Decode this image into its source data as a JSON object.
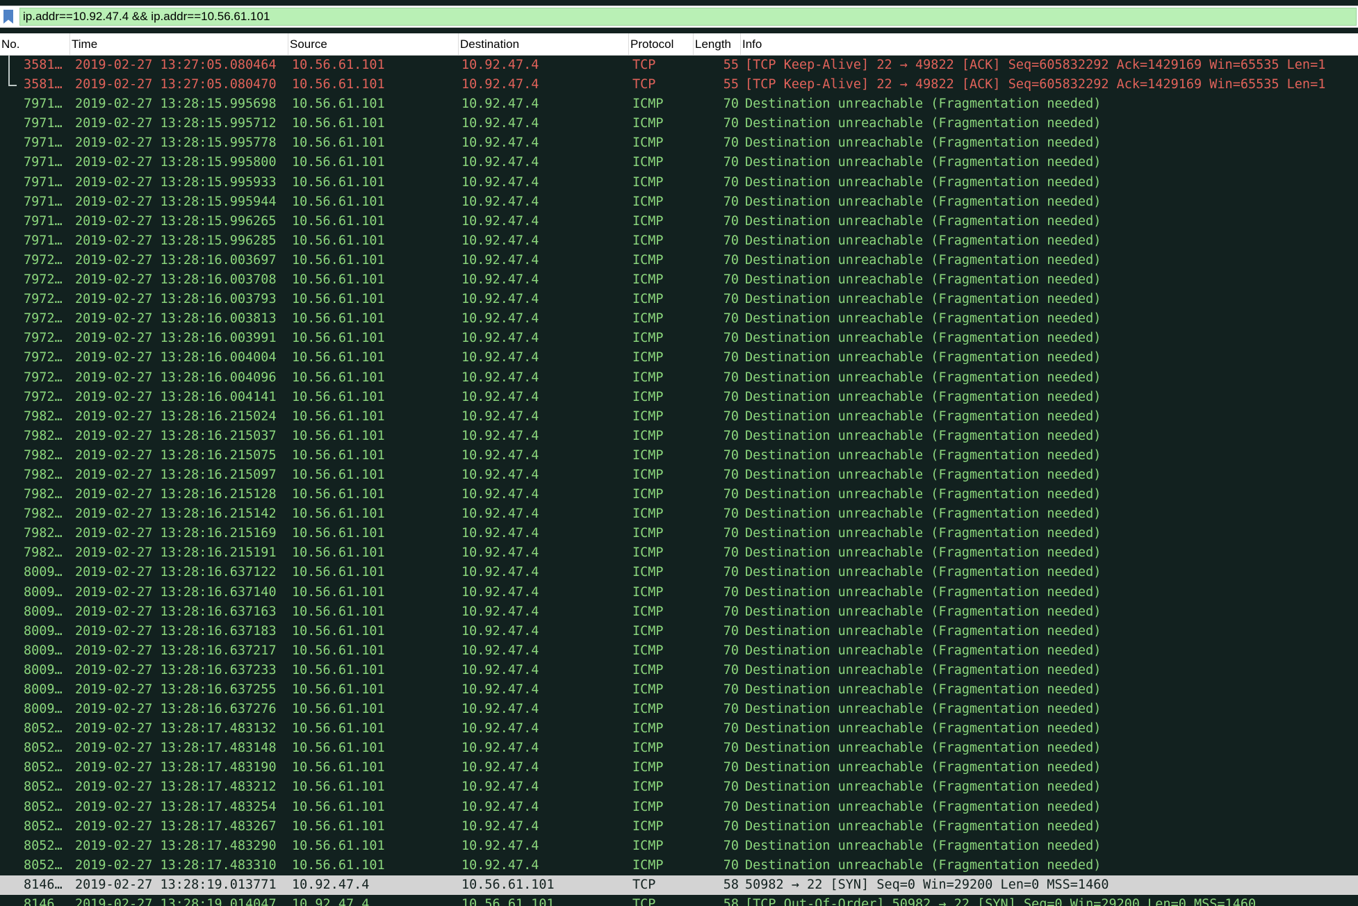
{
  "filter": {
    "value": "ip.addr==10.92.47.4 && ip.addr==10.56.61.101",
    "bookmark_icon": "bookmark-icon",
    "color": "#b9f0b5"
  },
  "columns": {
    "no": "No.",
    "time": "Time",
    "source": "Source",
    "destination": "Destination",
    "protocol": "Protocol",
    "length": "Length",
    "info": "Info"
  },
  "colors": {
    "tcp_keepalive_text": "#e0625a",
    "icmp_text": "#8bd67c",
    "row_background": "#12211f",
    "selected_row": "#d3d3d3"
  },
  "packets": [
    {
      "no": "3581…",
      "time": "2019-02-27 13:27:05.080464",
      "source": "10.56.61.101",
      "destination": "10.92.47.4",
      "protocol": "TCP",
      "length": "55",
      "info": "[TCP Keep-Alive] 22 → 49822 [ACK] Seq=605832292 Ack=1429169 Win=65535 Len=1",
      "type": "tcp-ka"
    },
    {
      "no": "3581…",
      "time": "2019-02-27 13:27:05.080470",
      "source": "10.56.61.101",
      "destination": "10.92.47.4",
      "protocol": "TCP",
      "length": "55",
      "info": "[TCP Keep-Alive] 22 → 49822 [ACK] Seq=605832292 Ack=1429169 Win=65535 Len=1",
      "type": "tcp-ka"
    },
    {
      "no": "7971…",
      "time": "2019-02-27 13:28:15.995698",
      "source": "10.56.61.101",
      "destination": "10.92.47.4",
      "protocol": "ICMP",
      "length": "70",
      "info": "Destination unreachable (Fragmentation needed)",
      "type": "icmp"
    },
    {
      "no": "7971…",
      "time": "2019-02-27 13:28:15.995712",
      "source": "10.56.61.101",
      "destination": "10.92.47.4",
      "protocol": "ICMP",
      "length": "70",
      "info": "Destination unreachable (Fragmentation needed)",
      "type": "icmp"
    },
    {
      "no": "7971…",
      "time": "2019-02-27 13:28:15.995778",
      "source": "10.56.61.101",
      "destination": "10.92.47.4",
      "protocol": "ICMP",
      "length": "70",
      "info": "Destination unreachable (Fragmentation needed)",
      "type": "icmp"
    },
    {
      "no": "7971…",
      "time": "2019-02-27 13:28:15.995800",
      "source": "10.56.61.101",
      "destination": "10.92.47.4",
      "protocol": "ICMP",
      "length": "70",
      "info": "Destination unreachable (Fragmentation needed)",
      "type": "icmp"
    },
    {
      "no": "7971…",
      "time": "2019-02-27 13:28:15.995933",
      "source": "10.56.61.101",
      "destination": "10.92.47.4",
      "protocol": "ICMP",
      "length": "70",
      "info": "Destination unreachable (Fragmentation needed)",
      "type": "icmp"
    },
    {
      "no": "7971…",
      "time": "2019-02-27 13:28:15.995944",
      "source": "10.56.61.101",
      "destination": "10.92.47.4",
      "protocol": "ICMP",
      "length": "70",
      "info": "Destination unreachable (Fragmentation needed)",
      "type": "icmp"
    },
    {
      "no": "7971…",
      "time": "2019-02-27 13:28:15.996265",
      "source": "10.56.61.101",
      "destination": "10.92.47.4",
      "protocol": "ICMP",
      "length": "70",
      "info": "Destination unreachable (Fragmentation needed)",
      "type": "icmp"
    },
    {
      "no": "7971…",
      "time": "2019-02-27 13:28:15.996285",
      "source": "10.56.61.101",
      "destination": "10.92.47.4",
      "protocol": "ICMP",
      "length": "70",
      "info": "Destination unreachable (Fragmentation needed)",
      "type": "icmp"
    },
    {
      "no": "7972…",
      "time": "2019-02-27 13:28:16.003697",
      "source": "10.56.61.101",
      "destination": "10.92.47.4",
      "protocol": "ICMP",
      "length": "70",
      "info": "Destination unreachable (Fragmentation needed)",
      "type": "icmp"
    },
    {
      "no": "7972…",
      "time": "2019-02-27 13:28:16.003708",
      "source": "10.56.61.101",
      "destination": "10.92.47.4",
      "protocol": "ICMP",
      "length": "70",
      "info": "Destination unreachable (Fragmentation needed)",
      "type": "icmp"
    },
    {
      "no": "7972…",
      "time": "2019-02-27 13:28:16.003793",
      "source": "10.56.61.101",
      "destination": "10.92.47.4",
      "protocol": "ICMP",
      "length": "70",
      "info": "Destination unreachable (Fragmentation needed)",
      "type": "icmp"
    },
    {
      "no": "7972…",
      "time": "2019-02-27 13:28:16.003813",
      "source": "10.56.61.101",
      "destination": "10.92.47.4",
      "protocol": "ICMP",
      "length": "70",
      "info": "Destination unreachable (Fragmentation needed)",
      "type": "icmp"
    },
    {
      "no": "7972…",
      "time": "2019-02-27 13:28:16.003991",
      "source": "10.56.61.101",
      "destination": "10.92.47.4",
      "protocol": "ICMP",
      "length": "70",
      "info": "Destination unreachable (Fragmentation needed)",
      "type": "icmp"
    },
    {
      "no": "7972…",
      "time": "2019-02-27 13:28:16.004004",
      "source": "10.56.61.101",
      "destination": "10.92.47.4",
      "protocol": "ICMP",
      "length": "70",
      "info": "Destination unreachable (Fragmentation needed)",
      "type": "icmp"
    },
    {
      "no": "7972…",
      "time": "2019-02-27 13:28:16.004096",
      "source": "10.56.61.101",
      "destination": "10.92.47.4",
      "protocol": "ICMP",
      "length": "70",
      "info": "Destination unreachable (Fragmentation needed)",
      "type": "icmp"
    },
    {
      "no": "7972…",
      "time": "2019-02-27 13:28:16.004141",
      "source": "10.56.61.101",
      "destination": "10.92.47.4",
      "protocol": "ICMP",
      "length": "70",
      "info": "Destination unreachable (Fragmentation needed)",
      "type": "icmp"
    },
    {
      "no": "7982…",
      "time": "2019-02-27 13:28:16.215024",
      "source": "10.56.61.101",
      "destination": "10.92.47.4",
      "protocol": "ICMP",
      "length": "70",
      "info": "Destination unreachable (Fragmentation needed)",
      "type": "icmp"
    },
    {
      "no": "7982…",
      "time": "2019-02-27 13:28:16.215037",
      "source": "10.56.61.101",
      "destination": "10.92.47.4",
      "protocol": "ICMP",
      "length": "70",
      "info": "Destination unreachable (Fragmentation needed)",
      "type": "icmp"
    },
    {
      "no": "7982…",
      "time": "2019-02-27 13:28:16.215075",
      "source": "10.56.61.101",
      "destination": "10.92.47.4",
      "protocol": "ICMP",
      "length": "70",
      "info": "Destination unreachable (Fragmentation needed)",
      "type": "icmp"
    },
    {
      "no": "7982…",
      "time": "2019-02-27 13:28:16.215097",
      "source": "10.56.61.101",
      "destination": "10.92.47.4",
      "protocol": "ICMP",
      "length": "70",
      "info": "Destination unreachable (Fragmentation needed)",
      "type": "icmp"
    },
    {
      "no": "7982…",
      "time": "2019-02-27 13:28:16.215128",
      "source": "10.56.61.101",
      "destination": "10.92.47.4",
      "protocol": "ICMP",
      "length": "70",
      "info": "Destination unreachable (Fragmentation needed)",
      "type": "icmp"
    },
    {
      "no": "7982…",
      "time": "2019-02-27 13:28:16.215142",
      "source": "10.56.61.101",
      "destination": "10.92.47.4",
      "protocol": "ICMP",
      "length": "70",
      "info": "Destination unreachable (Fragmentation needed)",
      "type": "icmp"
    },
    {
      "no": "7982…",
      "time": "2019-02-27 13:28:16.215169",
      "source": "10.56.61.101",
      "destination": "10.92.47.4",
      "protocol": "ICMP",
      "length": "70",
      "info": "Destination unreachable (Fragmentation needed)",
      "type": "icmp"
    },
    {
      "no": "7982…",
      "time": "2019-02-27 13:28:16.215191",
      "source": "10.56.61.101",
      "destination": "10.92.47.4",
      "protocol": "ICMP",
      "length": "70",
      "info": "Destination unreachable (Fragmentation needed)",
      "type": "icmp"
    },
    {
      "no": "8009…",
      "time": "2019-02-27 13:28:16.637122",
      "source": "10.56.61.101",
      "destination": "10.92.47.4",
      "protocol": "ICMP",
      "length": "70",
      "info": "Destination unreachable (Fragmentation needed)",
      "type": "icmp"
    },
    {
      "no": "8009…",
      "time": "2019-02-27 13:28:16.637140",
      "source": "10.56.61.101",
      "destination": "10.92.47.4",
      "protocol": "ICMP",
      "length": "70",
      "info": "Destination unreachable (Fragmentation needed)",
      "type": "icmp"
    },
    {
      "no": "8009…",
      "time": "2019-02-27 13:28:16.637163",
      "source": "10.56.61.101",
      "destination": "10.92.47.4",
      "protocol": "ICMP",
      "length": "70",
      "info": "Destination unreachable (Fragmentation needed)",
      "type": "icmp"
    },
    {
      "no": "8009…",
      "time": "2019-02-27 13:28:16.637183",
      "source": "10.56.61.101",
      "destination": "10.92.47.4",
      "protocol": "ICMP",
      "length": "70",
      "info": "Destination unreachable (Fragmentation needed)",
      "type": "icmp"
    },
    {
      "no": "8009…",
      "time": "2019-02-27 13:28:16.637217",
      "source": "10.56.61.101",
      "destination": "10.92.47.4",
      "protocol": "ICMP",
      "length": "70",
      "info": "Destination unreachable (Fragmentation needed)",
      "type": "icmp"
    },
    {
      "no": "8009…",
      "time": "2019-02-27 13:28:16.637233",
      "source": "10.56.61.101",
      "destination": "10.92.47.4",
      "protocol": "ICMP",
      "length": "70",
      "info": "Destination unreachable (Fragmentation needed)",
      "type": "icmp"
    },
    {
      "no": "8009…",
      "time": "2019-02-27 13:28:16.637255",
      "source": "10.56.61.101",
      "destination": "10.92.47.4",
      "protocol": "ICMP",
      "length": "70",
      "info": "Destination unreachable (Fragmentation needed)",
      "type": "icmp"
    },
    {
      "no": "8009…",
      "time": "2019-02-27 13:28:16.637276",
      "source": "10.56.61.101",
      "destination": "10.92.47.4",
      "protocol": "ICMP",
      "length": "70",
      "info": "Destination unreachable (Fragmentation needed)",
      "type": "icmp"
    },
    {
      "no": "8052…",
      "time": "2019-02-27 13:28:17.483132",
      "source": "10.56.61.101",
      "destination": "10.92.47.4",
      "protocol": "ICMP",
      "length": "70",
      "info": "Destination unreachable (Fragmentation needed)",
      "type": "icmp"
    },
    {
      "no": "8052…",
      "time": "2019-02-27 13:28:17.483148",
      "source": "10.56.61.101",
      "destination": "10.92.47.4",
      "protocol": "ICMP",
      "length": "70",
      "info": "Destination unreachable (Fragmentation needed)",
      "type": "icmp"
    },
    {
      "no": "8052…",
      "time": "2019-02-27 13:28:17.483190",
      "source": "10.56.61.101",
      "destination": "10.92.47.4",
      "protocol": "ICMP",
      "length": "70",
      "info": "Destination unreachable (Fragmentation needed)",
      "type": "icmp"
    },
    {
      "no": "8052…",
      "time": "2019-02-27 13:28:17.483212",
      "source": "10.56.61.101",
      "destination": "10.92.47.4",
      "protocol": "ICMP",
      "length": "70",
      "info": "Destination unreachable (Fragmentation needed)",
      "type": "icmp"
    },
    {
      "no": "8052…",
      "time": "2019-02-27 13:28:17.483254",
      "source": "10.56.61.101",
      "destination": "10.92.47.4",
      "protocol": "ICMP",
      "length": "70",
      "info": "Destination unreachable (Fragmentation needed)",
      "type": "icmp"
    },
    {
      "no": "8052…",
      "time": "2019-02-27 13:28:17.483267",
      "source": "10.56.61.101",
      "destination": "10.92.47.4",
      "protocol": "ICMP",
      "length": "70",
      "info": "Destination unreachable (Fragmentation needed)",
      "type": "icmp"
    },
    {
      "no": "8052…",
      "time": "2019-02-27 13:28:17.483290",
      "source": "10.56.61.101",
      "destination": "10.92.47.4",
      "protocol": "ICMP",
      "length": "70",
      "info": "Destination unreachable (Fragmentation needed)",
      "type": "icmp"
    },
    {
      "no": "8052…",
      "time": "2019-02-27 13:28:17.483310",
      "source": "10.56.61.101",
      "destination": "10.92.47.4",
      "protocol": "ICMP",
      "length": "70",
      "info": "Destination unreachable (Fragmentation needed)",
      "type": "icmp"
    },
    {
      "no": "8146…",
      "time": "2019-02-27 13:28:19.013771",
      "source": "10.92.47.4",
      "destination": "10.56.61.101",
      "protocol": "TCP",
      "length": "58",
      "info": "50982 → 22 [SYN] Seq=0 Win=29200 Len=0 MSS=1460",
      "type": "selected"
    },
    {
      "no": "8146…",
      "time": "2019-02-27 13:28:19.014047",
      "source": "10.92.47.4",
      "destination": "10.56.61.101",
      "protocol": "TCP",
      "length": "58",
      "info": "[TCP Out-Of-Order] 50982 → 22 [SYN] Seq=0 Win=29200 Len=0 MSS=1460",
      "type": "icmp"
    }
  ]
}
